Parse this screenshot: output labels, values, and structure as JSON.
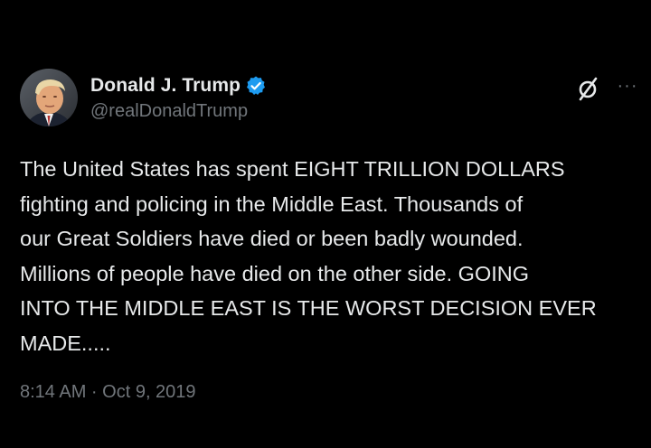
{
  "author": {
    "display_name": "Donald J. Trump",
    "handle": "@realDonaldTrump",
    "verified": true,
    "verified_color": "#1d9bf0"
  },
  "actions": {
    "grok_icon": "slashed-circle-icon",
    "more_icon": "more-dots-icon",
    "more_label": "···"
  },
  "tweet": {
    "text": "The United States has spent EIGHT TRILLION DOLLARS\nfighting and policing in the Middle East. Thousands of\nour Great Soldiers have died or been badly wounded.\nMillions of people have died on the other side. GOING\nINTO THE MIDDLE EAST IS THE WORST DECISION EVER\nMADE.....",
    "timestamp": "8:14 AM · Oct 9, 2019"
  },
  "colors": {
    "background": "#000000",
    "primary_text": "#e7e9ea",
    "secondary_text": "#71767b"
  }
}
